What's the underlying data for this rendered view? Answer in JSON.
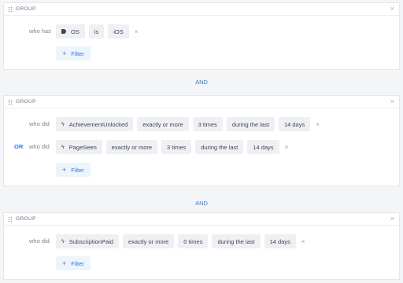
{
  "groups": [
    {
      "title": "GROUP",
      "rows": [
        {
          "prefix": "who has",
          "property_icon": "tag-icon",
          "property": "OS",
          "operator": "is",
          "value": "iOS"
        }
      ],
      "filter_label": "Filter"
    },
    {
      "title": "GROUP",
      "rows": [
        {
          "prefix": "who did",
          "event_icon": "lightning-icon",
          "event": "AchievementUnlocked",
          "comparison": "exactly or more",
          "count": "3 times",
          "window": "during the last",
          "period": "14 days"
        },
        {
          "connector": "OR",
          "prefix": "who did",
          "event_icon": "lightning-icon",
          "event": "PageSeen",
          "comparison": "exactly or more",
          "count": "3 times",
          "window": "during the last",
          "period": "14 days"
        }
      ],
      "filter_label": "Filter"
    },
    {
      "title": "GROUP",
      "rows": [
        {
          "prefix": "who did",
          "event_icon": "lightning-icon",
          "event": "SubscriptionPaid",
          "comparison": "exactly or more",
          "count": "0 times",
          "window": "during the last",
          "period": "14 days"
        }
      ],
      "filter_label": "Filter"
    }
  ],
  "connectors": [
    "AND",
    "AND"
  ],
  "close_glyph": "×",
  "add_glyph": "+",
  "colors": {
    "accent": "#2e7bd6",
    "pill_bg": "#eef0f3",
    "filter_bg": "#edf4fc",
    "page_bg": "#f4f5f7"
  }
}
